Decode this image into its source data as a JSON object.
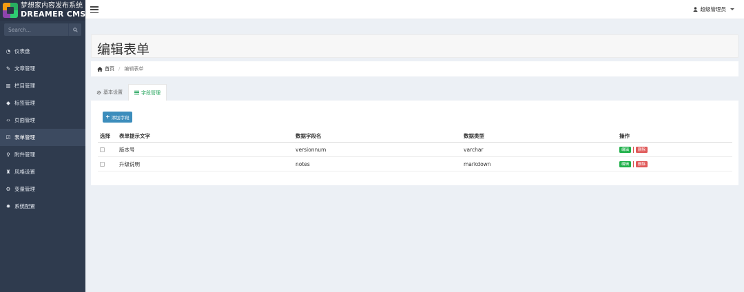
{
  "logo": {
    "cn": "梦想家内容发布系统",
    "en": "DREAMER CMS"
  },
  "search": {
    "placeholder": "Search..."
  },
  "nav": {
    "items": [
      {
        "label": "仪表盘",
        "icon": "dashboard-icon",
        "glyph": "◔"
      },
      {
        "label": "文章管理",
        "icon": "edit-icon",
        "glyph": "✎"
      },
      {
        "label": "栏目管理",
        "icon": "columns-icon",
        "glyph": "▥"
      },
      {
        "label": "标签管理",
        "icon": "tags-icon",
        "glyph": "◆"
      },
      {
        "label": "页面管理",
        "icon": "code-icon",
        "glyph": "‹›"
      },
      {
        "label": "表单管理",
        "icon": "checkbox-icon",
        "glyph": "☑"
      },
      {
        "label": "附件管理",
        "icon": "paperclip-icon",
        "glyph": "⚲"
      },
      {
        "label": "风格设置",
        "icon": "theme-icon",
        "glyph": "♜"
      },
      {
        "label": "变量管理",
        "icon": "cogs-icon",
        "glyph": "⚙"
      },
      {
        "label": "系统配置",
        "icon": "gear-icon",
        "glyph": "✹"
      }
    ],
    "active_index": 5
  },
  "header": {
    "user_label": "超级管理员"
  },
  "page": {
    "title": "编辑表单",
    "breadcrumb_home": "首页",
    "breadcrumb_current": "编辑表单"
  },
  "tabs": [
    {
      "label": "基本设置",
      "active": false
    },
    {
      "label": "字段管理",
      "active": true
    }
  ],
  "panel": {
    "add_button": "添加字段",
    "columns": [
      "选择",
      "表单提示文字",
      "数据字段名",
      "数据类型",
      "操作"
    ],
    "rows": [
      {
        "hint": "版本号",
        "field": "versionnum",
        "type": "varchar"
      },
      {
        "hint": "升级说明",
        "field": "notes",
        "type": "markdown"
      }
    ],
    "edit_label": "编辑",
    "delete_label": "删除"
  },
  "colors": {
    "sidebar_bg": "#2f3b4e",
    "primary": "#3c8dbc",
    "success": "#22b14c",
    "danger": "#e05a5a"
  }
}
